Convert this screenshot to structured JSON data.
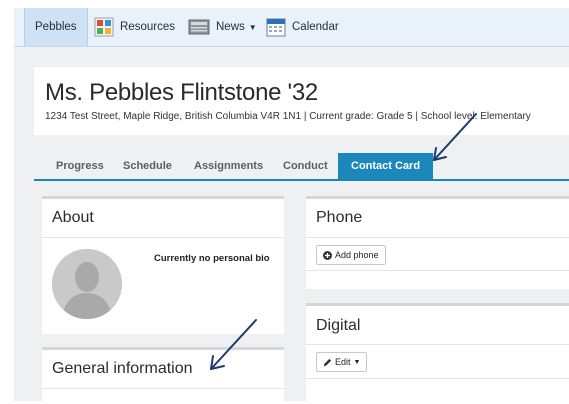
{
  "nav": {
    "items": [
      {
        "label": "Pebbles",
        "active": true
      },
      {
        "label": "Resources",
        "icon": "resources-icon"
      },
      {
        "label": "News",
        "icon": "news-icon",
        "has_dropdown": true
      },
      {
        "label": "Calendar",
        "icon": "calendar-icon"
      }
    ]
  },
  "student": {
    "name": "Ms. Pebbles Flintstone '32",
    "details": "1234 Test Street, Maple Ridge, British Columbia V4R 1N1 | Current grade: Grade 5 | School level: Elementary"
  },
  "tabs": [
    {
      "label": "Progress"
    },
    {
      "label": "Schedule"
    },
    {
      "label": "Assignments"
    },
    {
      "label": "Conduct"
    },
    {
      "label": "Contact Card",
      "active": true
    }
  ],
  "about": {
    "title": "About",
    "bio": "Currently no personal bio"
  },
  "general": {
    "title": "General information"
  },
  "phone": {
    "title": "Phone",
    "add_label": "Add phone"
  },
  "digital": {
    "title": "Digital",
    "edit_label": "Edit"
  },
  "colors": {
    "accent": "#1c87ba",
    "annotation_arrow": "#1f3a6e"
  }
}
